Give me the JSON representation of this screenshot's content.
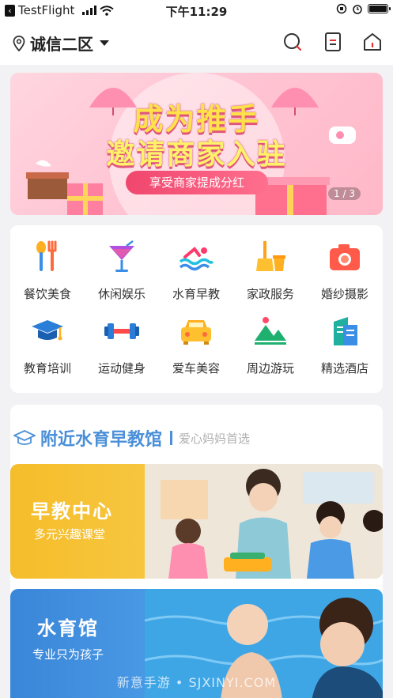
{
  "status_bar": {
    "app": "TestFlight",
    "time": "下午11:29"
  },
  "header": {
    "location": "诚信二区"
  },
  "banner": {
    "title_line1": "成为推手",
    "title_line2": "邀请商家入驻",
    "subtitle": "享受商家提成分红",
    "pager": "1 / 3"
  },
  "categories": [
    {
      "label": "餐饮美食",
      "icon": "fork-spoon-icon"
    },
    {
      "label": "休闲娱乐",
      "icon": "cocktail-icon"
    },
    {
      "label": "水育早教",
      "icon": "swimmer-icon"
    },
    {
      "label": "家政服务",
      "icon": "broom-bucket-icon"
    },
    {
      "label": "婚纱摄影",
      "icon": "camera-icon"
    },
    {
      "label": "教育培训",
      "icon": "graduation-cap-icon"
    },
    {
      "label": "运动健身",
      "icon": "dumbbell-icon"
    },
    {
      "label": "爱车美容",
      "icon": "car-icon"
    },
    {
      "label": "周边游玩",
      "icon": "mountain-icon"
    },
    {
      "label": "精选酒店",
      "icon": "hotel-building-icon"
    }
  ],
  "nearby": {
    "title": "附近水育早教馆",
    "subtitle": "爱心妈妈首选"
  },
  "cards": [
    {
      "title": "早教中心",
      "subtitle": "多元兴趣课堂"
    },
    {
      "title": "水育馆",
      "subtitle": "专业只为孩子"
    }
  ],
  "watermark": "新意手游 • SJXINYI.COM"
}
